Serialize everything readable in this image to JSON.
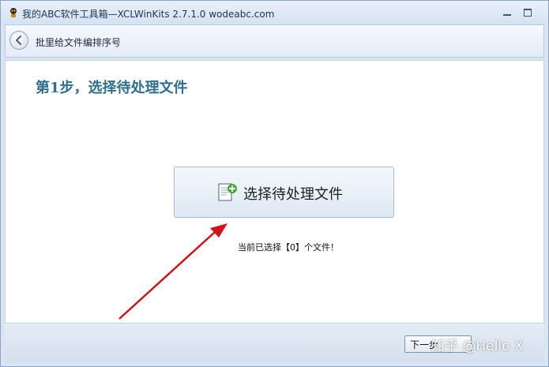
{
  "window": {
    "title": "我的ABC软件工具箱—XCLWinKits 2.7.1.0  wodeabc.com"
  },
  "header": {
    "title": "批里给文件编排序号"
  },
  "main": {
    "step_title": "第1步，选择待处理文件",
    "select_button_label": "选择待处理文件",
    "status_text": "当前已选择【0】个文件！"
  },
  "footer": {
    "next_label": "下一步",
    "watermark": "知乎 @Hello X"
  },
  "icons": {
    "app": "app-mascot-icon",
    "back": "back-arrow-icon",
    "file_add": "file-add-icon",
    "minimize": "minimize-icon",
    "maximize": "maximize-icon"
  },
  "colors": {
    "step_title": "#2f6f8f",
    "annotation_arrow": "#d0141d",
    "window_bg": "#dbe5f1"
  }
}
